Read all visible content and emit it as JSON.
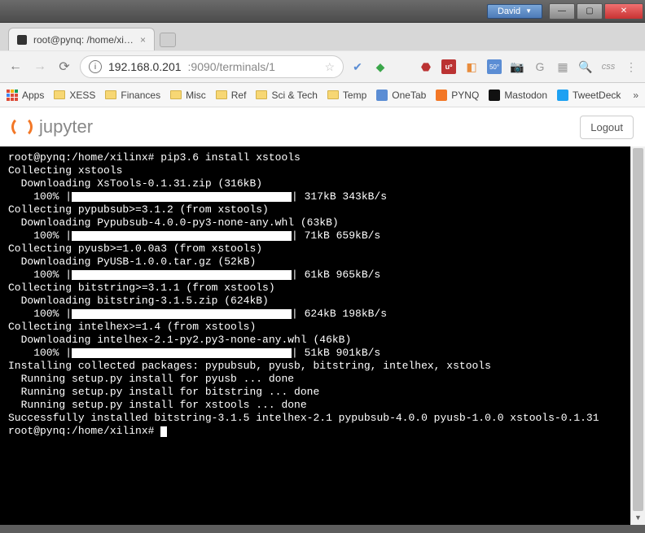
{
  "window": {
    "user_label": "David",
    "min": "—",
    "max": "▢",
    "close": "✕"
  },
  "chrome": {
    "tab_title": "root@pynq: /home/xilinx",
    "address_prefix": "192.168.0.201",
    "address_suffix": ":9090/terminals/1"
  },
  "bookmarks": {
    "apps_label": "Apps",
    "items": [
      {
        "label": "XESS",
        "kind": "folder"
      },
      {
        "label": "Finances",
        "kind": "folder"
      },
      {
        "label": "Misc",
        "kind": "folder"
      },
      {
        "label": "Ref",
        "kind": "folder"
      },
      {
        "label": "Sci & Tech",
        "kind": "folder"
      },
      {
        "label": "Temp",
        "kind": "folder"
      },
      {
        "label": "OneTab",
        "kind": "link",
        "color": "#5b8dd4"
      },
      {
        "label": "PYNQ",
        "kind": "link",
        "color": "#f37726"
      },
      {
        "label": "Mastodon",
        "kind": "link",
        "color": "#111"
      },
      {
        "label": "TweetDeck",
        "kind": "link",
        "color": "#1da1f2"
      }
    ]
  },
  "jupyter": {
    "brand": "jupyter",
    "logout": "Logout"
  },
  "terminal": {
    "lines": [
      "root@pynq:/home/xilinx# pip3.6 install xstools",
      "Collecting xstools",
      "  Downloading XsTools-0.1.31.zip (316kB)",
      {
        "progress": "    100% |",
        "bar": true,
        "tail": "| 317kB 343kB/s"
      },
      "Collecting pypubsub>=3.1.2 (from xstools)",
      "  Downloading Pypubsub-4.0.0-py3-none-any.whl (63kB)",
      {
        "progress": "    100% |",
        "bar": true,
        "tail": "| 71kB 659kB/s"
      },
      "Collecting pyusb>=1.0.0a3 (from xstools)",
      "  Downloading PyUSB-1.0.0.tar.gz (52kB)",
      {
        "progress": "    100% |",
        "bar": true,
        "tail": "| 61kB 965kB/s"
      },
      "Collecting bitstring>=3.1.1 (from xstools)",
      "  Downloading bitstring-3.1.5.zip (624kB)",
      {
        "progress": "    100% |",
        "bar": true,
        "tail": "| 624kB 198kB/s"
      },
      "Collecting intelhex>=1.4 (from xstools)",
      "  Downloading intelhex-2.1-py2.py3-none-any.whl (46kB)",
      {
        "progress": "    100% |",
        "bar": true,
        "tail": "| 51kB 901kB/s"
      },
      "Installing collected packages: pypubsub, pyusb, bitstring, intelhex, xstools",
      "  Running setup.py install for pyusb ... done",
      "  Running setup.py install for bitstring ... done",
      "  Running setup.py install for xstools ... done",
      "Successfully installed bitstring-3.1.5 intelhex-2.1 pypubsub-4.0.0 pyusb-1.0.0 xstools-0.1.31",
      {
        "prompt": "root@pynq:/home/xilinx# ",
        "cursor": true
      }
    ]
  }
}
